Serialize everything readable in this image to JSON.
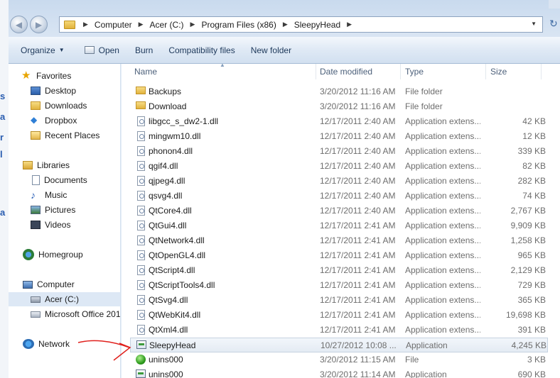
{
  "background_window": {
    "fragments": [
      "s",
      "a",
      "r",
      "l",
      "a"
    ]
  },
  "address": {
    "crumbs": [
      "Computer",
      "Acer (C:)",
      "Program Files (x86)",
      "SleepyHead"
    ]
  },
  "toolbar": {
    "organize": "Organize",
    "open": "Open",
    "burn": "Burn",
    "compatibility": "Compatibility files",
    "new_folder": "New folder"
  },
  "navpane": {
    "favorites": "Favorites",
    "desktop": "Desktop",
    "downloads": "Downloads",
    "dropbox": "Dropbox",
    "recent": "Recent Places",
    "libraries": "Libraries",
    "documents": "Documents",
    "music": "Music",
    "pictures": "Pictures",
    "videos": "Videos",
    "homegroup": "Homegroup",
    "computer": "Computer",
    "drive_c": "Acer (C:)",
    "office": "Microsoft Office 201",
    "network": "Network"
  },
  "columns": {
    "name": "Name",
    "date": "Date modified",
    "type": "Type",
    "size": "Size"
  },
  "files": [
    {
      "name": "Backups",
      "date": "3/20/2012 11:16 AM",
      "type": "File folder",
      "size": "",
      "icon": "folder-icon"
    },
    {
      "name": "Download",
      "date": "3/20/2012 11:16 AM",
      "type": "File folder",
      "size": "",
      "icon": "folder-icon"
    },
    {
      "name": "libgcc_s_dw2-1.dll",
      "date": "12/17/2011 2:40 AM",
      "type": "Application extens...",
      "size": "42 KB",
      "icon": "dll-icon"
    },
    {
      "name": "mingwm10.dll",
      "date": "12/17/2011 2:40 AM",
      "type": "Application extens...",
      "size": "12 KB",
      "icon": "dll-icon"
    },
    {
      "name": "phonon4.dll",
      "date": "12/17/2011 2:40 AM",
      "type": "Application extens...",
      "size": "339 KB",
      "icon": "dll-icon"
    },
    {
      "name": "qgif4.dll",
      "date": "12/17/2011 2:40 AM",
      "type": "Application extens...",
      "size": "82 KB",
      "icon": "dll-icon"
    },
    {
      "name": "qjpeg4.dll",
      "date": "12/17/2011 2:40 AM",
      "type": "Application extens...",
      "size": "282 KB",
      "icon": "dll-icon"
    },
    {
      "name": "qsvg4.dll",
      "date": "12/17/2011 2:40 AM",
      "type": "Application extens...",
      "size": "74 KB",
      "icon": "dll-icon"
    },
    {
      "name": "QtCore4.dll",
      "date": "12/17/2011 2:40 AM",
      "type": "Application extens...",
      "size": "2,767 KB",
      "icon": "dll-icon"
    },
    {
      "name": "QtGui4.dll",
      "date": "12/17/2011 2:41 AM",
      "type": "Application extens...",
      "size": "9,909 KB",
      "icon": "dll-icon"
    },
    {
      "name": "QtNetwork4.dll",
      "date": "12/17/2011 2:41 AM",
      "type": "Application extens...",
      "size": "1,258 KB",
      "icon": "dll-icon"
    },
    {
      "name": "QtOpenGL4.dll",
      "date": "12/17/2011 2:41 AM",
      "type": "Application extens...",
      "size": "965 KB",
      "icon": "dll-icon"
    },
    {
      "name": "QtScript4.dll",
      "date": "12/17/2011 2:41 AM",
      "type": "Application extens...",
      "size": "2,129 KB",
      "icon": "dll-icon"
    },
    {
      "name": "QtScriptTools4.dll",
      "date": "12/17/2011 2:41 AM",
      "type": "Application extens...",
      "size": "729 KB",
      "icon": "dll-icon"
    },
    {
      "name": "QtSvg4.dll",
      "date": "12/17/2011 2:41 AM",
      "type": "Application extens...",
      "size": "365 KB",
      "icon": "dll-icon"
    },
    {
      "name": "QtWebKit4.dll",
      "date": "12/17/2011 2:41 AM",
      "type": "Application extens...",
      "size": "19,698 KB",
      "icon": "dll-icon"
    },
    {
      "name": "QtXml4.dll",
      "date": "12/17/2011 2:41 AM",
      "type": "Application extens...",
      "size": "391 KB",
      "icon": "dll-icon"
    },
    {
      "name": "SleepyHead",
      "date": "10/27/2012 10:08 ...",
      "type": "Application",
      "size": "4,245 KB",
      "icon": "application-icon"
    },
    {
      "name": "unins000",
      "date": "3/20/2012 11:15 AM",
      "type": "File",
      "size": "3 KB",
      "icon": "green-orb-icon"
    },
    {
      "name": "unins000",
      "date": "3/20/2012 11:14 AM",
      "type": "Application",
      "size": "690 KB",
      "icon": "application-icon"
    }
  ],
  "colors": {
    "selection": "#dde8f5",
    "annotation_arrow": "#e0201c"
  }
}
